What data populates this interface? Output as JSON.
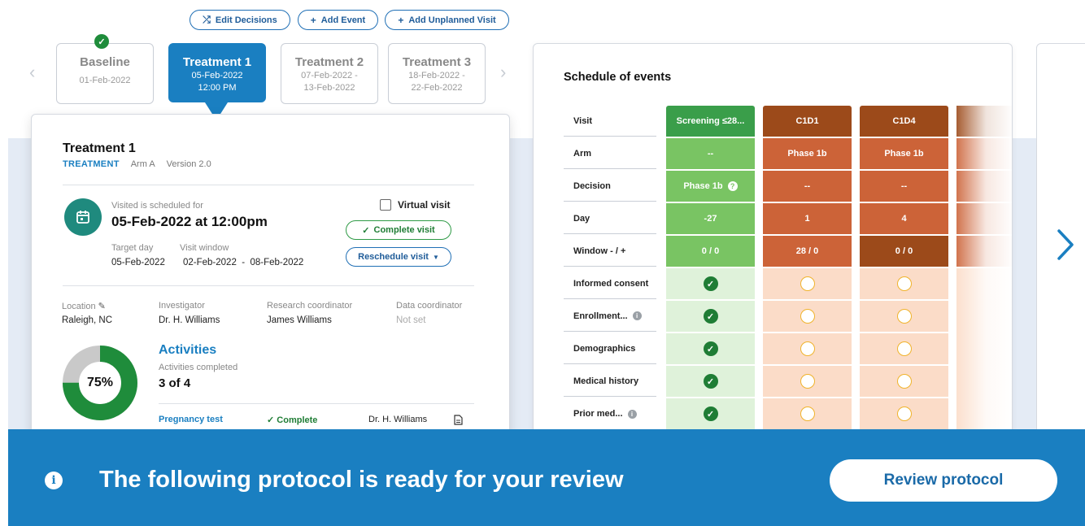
{
  "actions": {
    "edit_decisions": "Edit Decisions",
    "add_event": "Add Event",
    "add_unplanned_visit": "Add Unplanned Visit"
  },
  "visit_tabs": [
    {
      "title": "Baseline",
      "date": "01-Feb-2022",
      "status": "completed"
    },
    {
      "title": "Treatment 1",
      "date": "05-Feb-2022",
      "time": "12:00 PM",
      "status": "active"
    },
    {
      "title": "Treatment 2",
      "date": "07-Feb-2022 -",
      "date2": "13-Feb-2022"
    },
    {
      "title": "Treatment 3",
      "date": "18-Feb-2022 -",
      "date2": "22-Feb-2022"
    }
  ],
  "visit": {
    "title": "Treatment 1",
    "kind": "TREATMENT",
    "arm": "Arm A",
    "version": "Version 2.0",
    "scheduled_label": "Visited is scheduled for",
    "scheduled_value": "05-Feb-2022 at 12:00pm",
    "virtual_visit_label": "Virtual visit",
    "target_day_label": "Target day",
    "target_day_value": "05-Feb-2022",
    "window_label": "Visit window",
    "window_value": "02-Feb-2022  -  08-Feb-2022",
    "complete_visit": "Complete visit",
    "reschedule_visit": "Reschedule visit",
    "location_label": "Location",
    "location_value": "Raleigh, NC",
    "investigator_label": "Investigator",
    "investigator_value": "Dr. H. Williams",
    "research_coord_label": "Research coordinator",
    "research_coord_value": "James Williams",
    "data_coord_label": "Data coordinator",
    "data_coord_value": "Not set",
    "activities_title": "Activities",
    "activities_completed_label": "Activities completed",
    "activities_count": "3 of 4",
    "progress_label": "75%",
    "progress_fraction": 0.75,
    "activity_rows": [
      {
        "name": "Pregnancy test",
        "status": "Complete",
        "by": "Dr. H. Williams"
      }
    ]
  },
  "schedule": {
    "title": "Schedule of events",
    "row_labels": [
      "Visit",
      "Arm",
      "Decision",
      "Day",
      "Window - / +",
      "Informed consent",
      "Enrollment...",
      "Demographics",
      "Medical history",
      "Prior med..."
    ],
    "columns": [
      {
        "visit": "Screening ≤28...",
        "arm": "--",
        "decision": "Phase 1b",
        "day": "-27",
        "window": "0 / 0"
      },
      {
        "visit": "C1D1",
        "arm": "Phase 1b",
        "decision": "--",
        "day": "1",
        "window": "28 / 0"
      },
      {
        "visit": "C1D4",
        "arm": "Phase 1b",
        "decision": "--",
        "day": "4",
        "window": "0 / 0"
      }
    ]
  },
  "banner": {
    "text": "The following protocol is ready for your review",
    "button": "Review protocol"
  },
  "colors": {
    "primary": "#1a7fc1",
    "green": "#1f8c3b",
    "screening_green": "#72bf5f",
    "orange": "#cc6338",
    "dark_orange": "#9c4a1a"
  }
}
